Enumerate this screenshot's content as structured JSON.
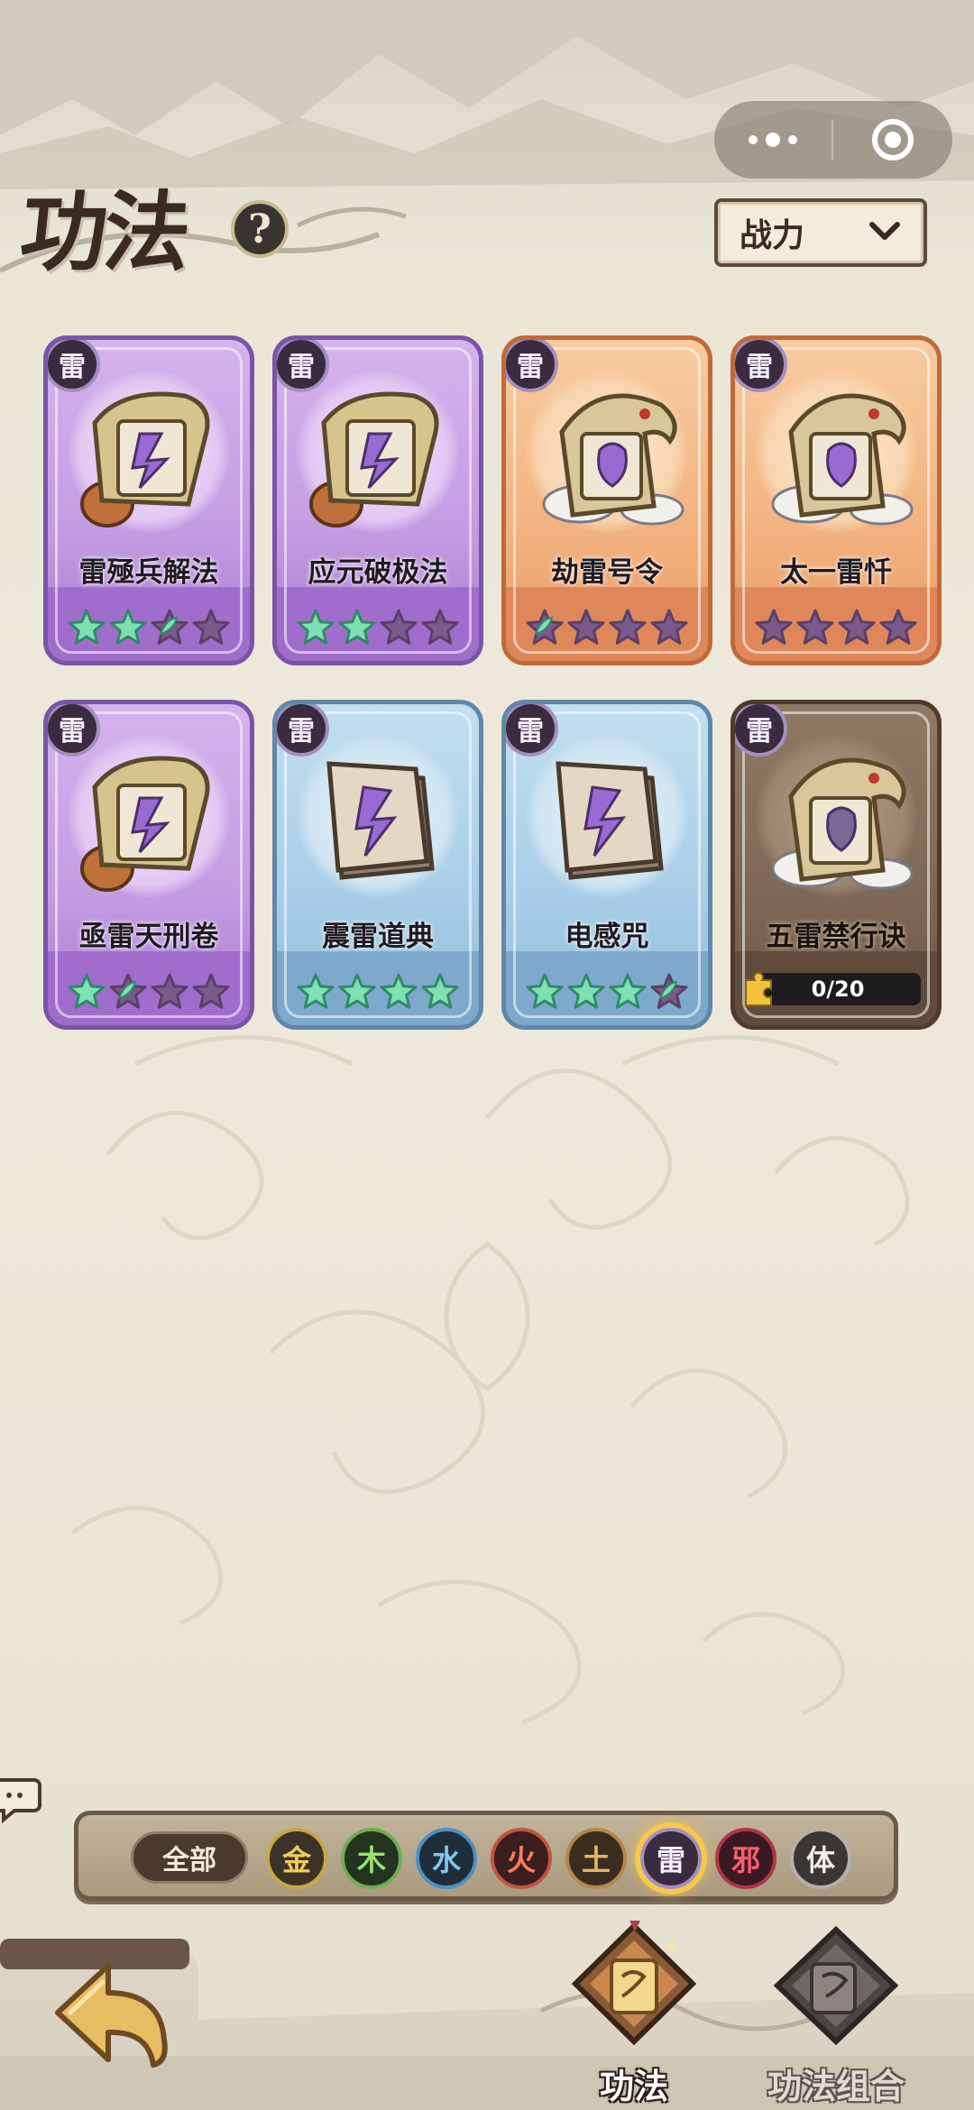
{
  "header": {
    "title": "功法",
    "help_label": "?",
    "sort": {
      "selected": "战力"
    }
  },
  "colors": {
    "purple_card": "#c39be2",
    "orange_card": "#f2b27f",
    "blue_card": "#a8cee6",
    "brown_card": "#7c6854",
    "star_filled": "#7fe0b4",
    "star_empty": "#8a6a9a"
  },
  "cards": [
    {
      "name": "雷殛兵解法",
      "element": "雷",
      "rarity": "purple",
      "stars_filled": 2,
      "stars_half": 1,
      "stars_total": 4,
      "icon": "scroll-sword-icon"
    },
    {
      "name": "应元破极法",
      "element": "雷",
      "rarity": "purple",
      "stars_filled": 2,
      "stars_half": 0,
      "stars_total": 4,
      "icon": "scroll-spirit-icon"
    },
    {
      "name": "劫雷号令",
      "element": "雷",
      "rarity": "orange",
      "stars_filled": 0,
      "stars_half": 1,
      "stars_total": 4,
      "icon": "dragon-palm-icon"
    },
    {
      "name": "太一雷忏",
      "element": "雷",
      "rarity": "orange",
      "stars_filled": 0,
      "stars_half": 0,
      "stars_total": 4,
      "icon": "dragon-spirit-icon"
    },
    {
      "name": "亟雷天刑卷",
      "element": "雷",
      "rarity": "purple",
      "stars_filled": 1,
      "stars_half": 1,
      "stars_total": 4,
      "icon": "scroll-lightning-icon"
    },
    {
      "name": "震雷道典",
      "element": "雷",
      "rarity": "blue",
      "stars_filled": 4,
      "stars_half": 0,
      "stars_total": 4,
      "icon": "book-hand-icon"
    },
    {
      "name": "电感咒",
      "element": "雷",
      "rarity": "blue",
      "stars_filled": 3,
      "stars_half": 1,
      "stars_total": 4,
      "icon": "book-lightning-icon"
    },
    {
      "name": "五雷禁行诀",
      "element": "雷",
      "rarity": "brown",
      "progress_text": "0/20",
      "progress": 0,
      "icon": "dragon-seal-icon"
    }
  ],
  "filters": {
    "all_label": "全部",
    "elements": [
      {
        "label": "金",
        "bg": "#3c3326",
        "border": "#c9a64a",
        "fg": "#f1cc5c",
        "selected": false
      },
      {
        "label": "木",
        "bg": "#24331f",
        "border": "#6fae4f",
        "fg": "#9be06e",
        "selected": false
      },
      {
        "label": "水",
        "bg": "#1f2c3a",
        "border": "#4e8fc1",
        "fg": "#7fc6f2",
        "selected": false
      },
      {
        "label": "火",
        "bg": "#3a1f1f",
        "border": "#c2553f",
        "fg": "#ff7b5c",
        "selected": false
      },
      {
        "label": "土",
        "bg": "#3a2d20",
        "border": "#b4874a",
        "fg": "#e5b46a",
        "selected": false
      },
      {
        "label": "雷",
        "bg": "#3a2b3f",
        "border": "#a48fbf",
        "fg": "#f4eefa",
        "selected": true
      },
      {
        "label": "邪",
        "bg": "#3a1a22",
        "border": "#b03546",
        "fg": "#ff5c70",
        "selected": false
      },
      {
        "label": "体",
        "bg": "#3a3636",
        "border": "#b7b0a6",
        "fg": "#f2efe9",
        "selected": false
      }
    ]
  },
  "nav": {
    "tabs": [
      {
        "label": "功法",
        "active": true
      },
      {
        "label": "功法组合",
        "active": false
      }
    ]
  }
}
